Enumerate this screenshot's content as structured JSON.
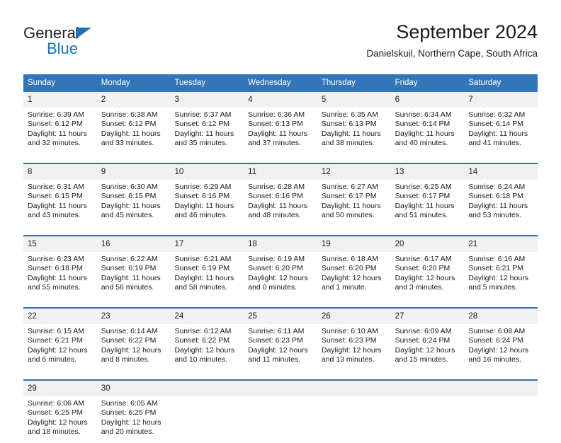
{
  "brand": {
    "name_part1": "General",
    "name_part2": "Blue",
    "accent_color": "#1d70b8"
  },
  "header": {
    "title": "September 2024",
    "subtitle": "Danielskuil, Northern Cape, South Africa"
  },
  "calendar": {
    "header_bg": "#3275b8",
    "daynum_bg": "#f1f1f1",
    "weekdays": [
      "Sunday",
      "Monday",
      "Tuesday",
      "Wednesday",
      "Thursday",
      "Friday",
      "Saturday"
    ],
    "weeks": [
      [
        {
          "day": "1",
          "sunrise": "Sunrise: 6:39 AM",
          "sunset": "Sunset: 6:12 PM",
          "daylight1": "Daylight: 11 hours",
          "daylight2": "and 32 minutes."
        },
        {
          "day": "2",
          "sunrise": "Sunrise: 6:38 AM",
          "sunset": "Sunset: 6:12 PM",
          "daylight1": "Daylight: 11 hours",
          "daylight2": "and 33 minutes."
        },
        {
          "day": "3",
          "sunrise": "Sunrise: 6:37 AM",
          "sunset": "Sunset: 6:12 PM",
          "daylight1": "Daylight: 11 hours",
          "daylight2": "and 35 minutes."
        },
        {
          "day": "4",
          "sunrise": "Sunrise: 6:36 AM",
          "sunset": "Sunset: 6:13 PM",
          "daylight1": "Daylight: 11 hours",
          "daylight2": "and 37 minutes."
        },
        {
          "day": "5",
          "sunrise": "Sunrise: 6:35 AM",
          "sunset": "Sunset: 6:13 PM",
          "daylight1": "Daylight: 11 hours",
          "daylight2": "and 38 minutes."
        },
        {
          "day": "6",
          "sunrise": "Sunrise: 6:34 AM",
          "sunset": "Sunset: 6:14 PM",
          "daylight1": "Daylight: 11 hours",
          "daylight2": "and 40 minutes."
        },
        {
          "day": "7",
          "sunrise": "Sunrise: 6:32 AM",
          "sunset": "Sunset: 6:14 PM",
          "daylight1": "Daylight: 11 hours",
          "daylight2": "and 41 minutes."
        }
      ],
      [
        {
          "day": "8",
          "sunrise": "Sunrise: 6:31 AM",
          "sunset": "Sunset: 6:15 PM",
          "daylight1": "Daylight: 11 hours",
          "daylight2": "and 43 minutes."
        },
        {
          "day": "9",
          "sunrise": "Sunrise: 6:30 AM",
          "sunset": "Sunset: 6:15 PM",
          "daylight1": "Daylight: 11 hours",
          "daylight2": "and 45 minutes."
        },
        {
          "day": "10",
          "sunrise": "Sunrise: 6:29 AM",
          "sunset": "Sunset: 6:16 PM",
          "daylight1": "Daylight: 11 hours",
          "daylight2": "and 46 minutes."
        },
        {
          "day": "11",
          "sunrise": "Sunrise: 6:28 AM",
          "sunset": "Sunset: 6:16 PM",
          "daylight1": "Daylight: 11 hours",
          "daylight2": "and 48 minutes."
        },
        {
          "day": "12",
          "sunrise": "Sunrise: 6:27 AM",
          "sunset": "Sunset: 6:17 PM",
          "daylight1": "Daylight: 11 hours",
          "daylight2": "and 50 minutes."
        },
        {
          "day": "13",
          "sunrise": "Sunrise: 6:25 AM",
          "sunset": "Sunset: 6:17 PM",
          "daylight1": "Daylight: 11 hours",
          "daylight2": "and 51 minutes."
        },
        {
          "day": "14",
          "sunrise": "Sunrise: 6:24 AM",
          "sunset": "Sunset: 6:18 PM",
          "daylight1": "Daylight: 11 hours",
          "daylight2": "and 53 minutes."
        }
      ],
      [
        {
          "day": "15",
          "sunrise": "Sunrise: 6:23 AM",
          "sunset": "Sunset: 6:18 PM",
          "daylight1": "Daylight: 11 hours",
          "daylight2": "and 55 minutes."
        },
        {
          "day": "16",
          "sunrise": "Sunrise: 6:22 AM",
          "sunset": "Sunset: 6:19 PM",
          "daylight1": "Daylight: 11 hours",
          "daylight2": "and 56 minutes."
        },
        {
          "day": "17",
          "sunrise": "Sunrise: 6:21 AM",
          "sunset": "Sunset: 6:19 PM",
          "daylight1": "Daylight: 11 hours",
          "daylight2": "and 58 minutes."
        },
        {
          "day": "18",
          "sunrise": "Sunrise: 6:19 AM",
          "sunset": "Sunset: 6:20 PM",
          "daylight1": "Daylight: 12 hours",
          "daylight2": "and 0 minutes."
        },
        {
          "day": "19",
          "sunrise": "Sunrise: 6:18 AM",
          "sunset": "Sunset: 6:20 PM",
          "daylight1": "Daylight: 12 hours",
          "daylight2": "and 1 minute."
        },
        {
          "day": "20",
          "sunrise": "Sunrise: 6:17 AM",
          "sunset": "Sunset: 6:20 PM",
          "daylight1": "Daylight: 12 hours",
          "daylight2": "and 3 minutes."
        },
        {
          "day": "21",
          "sunrise": "Sunrise: 6:16 AM",
          "sunset": "Sunset: 6:21 PM",
          "daylight1": "Daylight: 12 hours",
          "daylight2": "and 5 minutes."
        }
      ],
      [
        {
          "day": "22",
          "sunrise": "Sunrise: 6:15 AM",
          "sunset": "Sunset: 6:21 PM",
          "daylight1": "Daylight: 12 hours",
          "daylight2": "and 6 minutes."
        },
        {
          "day": "23",
          "sunrise": "Sunrise: 6:14 AM",
          "sunset": "Sunset: 6:22 PM",
          "daylight1": "Daylight: 12 hours",
          "daylight2": "and 8 minutes."
        },
        {
          "day": "24",
          "sunrise": "Sunrise: 6:12 AM",
          "sunset": "Sunset: 6:22 PM",
          "daylight1": "Daylight: 12 hours",
          "daylight2": "and 10 minutes."
        },
        {
          "day": "25",
          "sunrise": "Sunrise: 6:11 AM",
          "sunset": "Sunset: 6:23 PM",
          "daylight1": "Daylight: 12 hours",
          "daylight2": "and 11 minutes."
        },
        {
          "day": "26",
          "sunrise": "Sunrise: 6:10 AM",
          "sunset": "Sunset: 6:23 PM",
          "daylight1": "Daylight: 12 hours",
          "daylight2": "and 13 minutes."
        },
        {
          "day": "27",
          "sunrise": "Sunrise: 6:09 AM",
          "sunset": "Sunset: 6:24 PM",
          "daylight1": "Daylight: 12 hours",
          "daylight2": "and 15 minutes."
        },
        {
          "day": "28",
          "sunrise": "Sunrise: 6:08 AM",
          "sunset": "Sunset: 6:24 PM",
          "daylight1": "Daylight: 12 hours",
          "daylight2": "and 16 minutes."
        }
      ],
      [
        {
          "day": "29",
          "sunrise": "Sunrise: 6:06 AM",
          "sunset": "Sunset: 6:25 PM",
          "daylight1": "Daylight: 12 hours",
          "daylight2": "and 18 minutes."
        },
        {
          "day": "30",
          "sunrise": "Sunrise: 6:05 AM",
          "sunset": "Sunset: 6:25 PM",
          "daylight1": "Daylight: 12 hours",
          "daylight2": "and 20 minutes."
        },
        {
          "day": "",
          "sunrise": "",
          "sunset": "",
          "daylight1": "",
          "daylight2": ""
        },
        {
          "day": "",
          "sunrise": "",
          "sunset": "",
          "daylight1": "",
          "daylight2": ""
        },
        {
          "day": "",
          "sunrise": "",
          "sunset": "",
          "daylight1": "",
          "daylight2": ""
        },
        {
          "day": "",
          "sunrise": "",
          "sunset": "",
          "daylight1": "",
          "daylight2": ""
        },
        {
          "day": "",
          "sunrise": "",
          "sunset": "",
          "daylight1": "",
          "daylight2": ""
        }
      ]
    ]
  }
}
